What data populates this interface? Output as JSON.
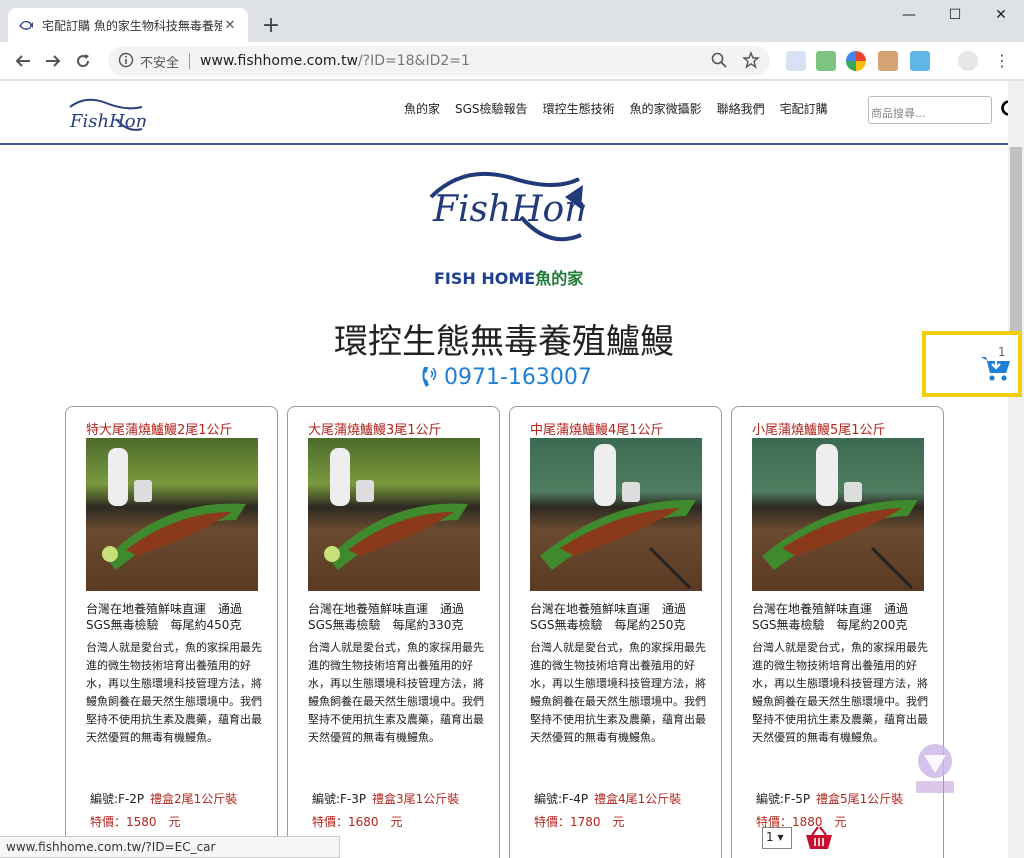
{
  "browser": {
    "tab_title": "宅配訂購 魚的家生物科技無毒養殖",
    "address_security": "不安全",
    "address_domain": "www.fishhome.com.tw",
    "address_path": "/?ID=18&ID2=1",
    "status_url": "www.fishhome.com.tw/?ID=EC_car"
  },
  "header": {
    "nav": [
      "魚的家",
      "SGS檢驗報告",
      "環控生態技術",
      "魚的家微攝影",
      "聯絡我們",
      "宅配訂購"
    ],
    "search_placeholder": "商品搜尋..."
  },
  "hero": {
    "brand_en": "FISH HOME",
    "brand_cn": "魚的家",
    "title": "環控生態無毒養殖鱸鰻",
    "phone": "0971-163007"
  },
  "cart": {
    "count": "1",
    "qty": "1"
  },
  "products": [
    {
      "title": "特大尾蒲燒鱸鰻2尾1公斤",
      "lead": "台灣在地養殖鮮味直運　通過SGS無毒檢驗　每尾約450克",
      "desc": "台灣人就是愛台式，魚的家採用最先進的微生物技術培育出養殖用的好水，再以生態環境科技管理方法，將鰻魚飼養在最天然生態環境中。我們堅持不使用抗生素及農藥，蘊育出最天然優質的無毒有機鰻魚。",
      "code": "編號:F-2P",
      "pack": "禮盒2尾1公斤裝",
      "price": "特價：1580　元"
    },
    {
      "title": "大尾蒲燒鱸鰻3尾1公斤",
      "lead": "台灣在地養殖鮮味直運　通過SGS無毒檢驗　每尾約330克",
      "desc": "台灣人就是愛台式，魚的家採用最先進的微生物技術培育出養殖用的好水，再以生態環境科技管理方法，將鰻魚飼養在最天然生態環境中。我們堅持不使用抗生素及農藥，蘊育出最天然優質的無毒有機鰻魚。",
      "code": "編號:F-3P",
      "pack": "禮盒3尾1公斤裝",
      "price": "特價：1680　元"
    },
    {
      "title": "中尾蒲燒鱸鰻4尾1公斤",
      "lead": "台灣在地養殖鮮味直運　通過SGS無毒檢驗　每尾約250克",
      "desc": "台灣人就是愛台式，魚的家採用最先進的微生物技術培育出養殖用的好水，再以生態環境科技管理方法，將鰻魚飼養在最天然生態環境中。我們堅持不使用抗生素及農藥，蘊育出最天然優質的無毒有機鰻魚。",
      "code": "編號:F-4P",
      "pack": "禮盒4尾1公斤裝",
      "price": "特價：1780　元"
    },
    {
      "title": "小尾蒲燒鱸鰻5尾1公斤",
      "lead": "台灣在地養殖鮮味直運　通過SGS無毒檢驗　每尾約200克",
      "desc": "台灣人就是愛台式，魚的家採用最先進的微生物技術培育出養殖用的好水，再以生態環境科技管理方法，將鰻魚飼養在最天然生態環境中。我們堅持不使用抗生素及農藥，蘊育出最天然優質的無毒有機鰻魚。",
      "code": "編號:F-5P",
      "pack": "禮盒5尾1公斤裝",
      "price": "特價：1880　元"
    }
  ],
  "colors": {
    "accent_red": "#b3261e",
    "phone_blue": "#1d7fd6",
    "highlight_yellow": "#f2cf0e",
    "brand_navy": "#1f3f8f"
  }
}
